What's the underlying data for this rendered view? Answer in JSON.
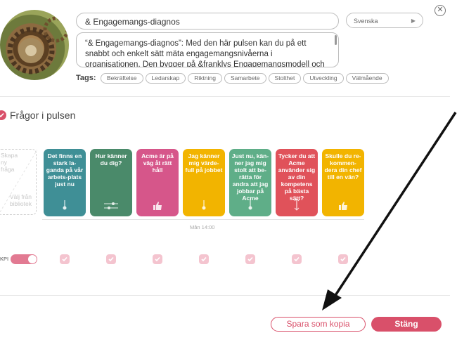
{
  "header": {
    "title_value": "& Engagemangs-diagnos",
    "language": "Svenska",
    "close_symbol": "✕",
    "description": "“& Engagemangs-diagnos”: Med den här pulsen kan du på ett snabbt och enkelt sätt mäta engagemangsnivåerna i organisationen. Den bygger på &franklys Engagemangsmodell och",
    "tags_label": "Tags:",
    "tags": [
      "Bekräftelse",
      "Ledarskap",
      "Riktning",
      "Samarbete",
      "Stolthet",
      "Utveckling",
      "Välmående"
    ]
  },
  "section": {
    "title": "Frågor i pulsen"
  },
  "add_card": {
    "create_label": "Skapa ny fråga",
    "library_label": "Välj från bibliotek"
  },
  "questions": [
    {
      "text": "Det finns en stark la-ganda på vår arbets-plats just nu",
      "color": "#3f8f96",
      "icon": "thermometer-icon"
    },
    {
      "text": "Hur känner du dig?",
      "color": "#4a8a6a",
      "icon": "slider-icon"
    },
    {
      "text": "Acme är på väg åt rätt håll",
      "color": "#d6568a",
      "icon": "thumbs-up-icon"
    },
    {
      "text": "Jag känner mig värde-full på jobbet",
      "color": "#f2b400",
      "icon": "thermometer-icon"
    },
    {
      "text": "Just nu, kän-ner jag mig stolt att be-rätta för andra att jag jobbar på Acme",
      "color": "#5fae88",
      "icon": "thermometer-icon"
    },
    {
      "text": "Tycker du att Acme använder sig av din kompetens på bästa sätt?",
      "color": "#e0525a",
      "icon": "range-icon"
    },
    {
      "text": "Skulle du re-kommen-dera din chef till en vän?",
      "color": "#f2b400",
      "icon": "thumbs-up-icon"
    }
  ],
  "timeline": {
    "label": "Mån 14:00"
  },
  "kpi": {
    "label": "KPI"
  },
  "footer": {
    "copy_label": "Spara som kopia",
    "close_label": "Stäng"
  },
  "colors": {
    "accent": "#d9506a"
  }
}
